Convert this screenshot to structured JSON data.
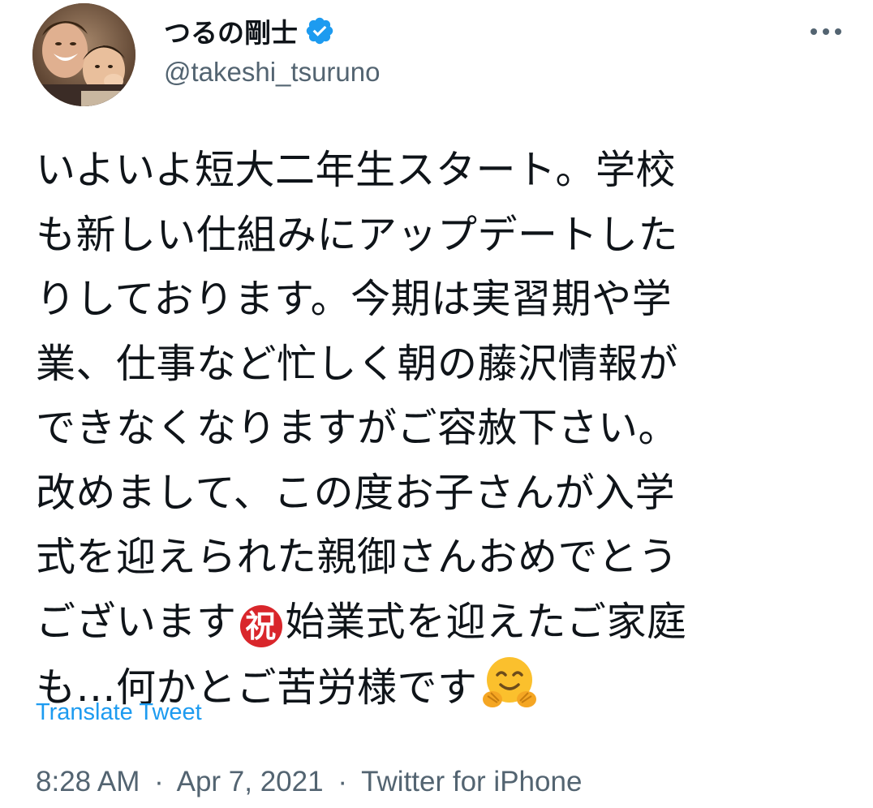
{
  "author": {
    "display_name": "つるの剛士",
    "handle": "@takeshi_tsuruno",
    "verified": true,
    "avatar_icon": "avatar-photo"
  },
  "more_icon": "more-options-icon",
  "tweet": {
    "lines": [
      "いよいよ短大二年生スタート。学校",
      "も新しい仕組みにアップデートした",
      "りしております。今期は実習期や学",
      "業、仕事など忙しく朝の藤沢情報が",
      "できなくなりますがご容赦下さい。",
      "改めまして、この度お子さんが入学",
      "式を迎えられた親御さんおめでとう"
    ],
    "line8_before": "ございます",
    "celebrate_char": "祝",
    "line8_after": "始業式を迎えたご家庭",
    "line9": "も…何かとご苦労様です",
    "emoji_end": "hugging-face-emoji"
  },
  "translate_label": "Translate Tweet",
  "meta": {
    "time": "8:28 AM",
    "separator": "·",
    "date": "Apr 7, 2021",
    "source": "Twitter for iPhone"
  },
  "colors": {
    "text": "#0f1419",
    "secondary": "#536471",
    "link": "#1d9bf0",
    "verified": "#1d9bf0",
    "celebrate": "#d9262b"
  }
}
